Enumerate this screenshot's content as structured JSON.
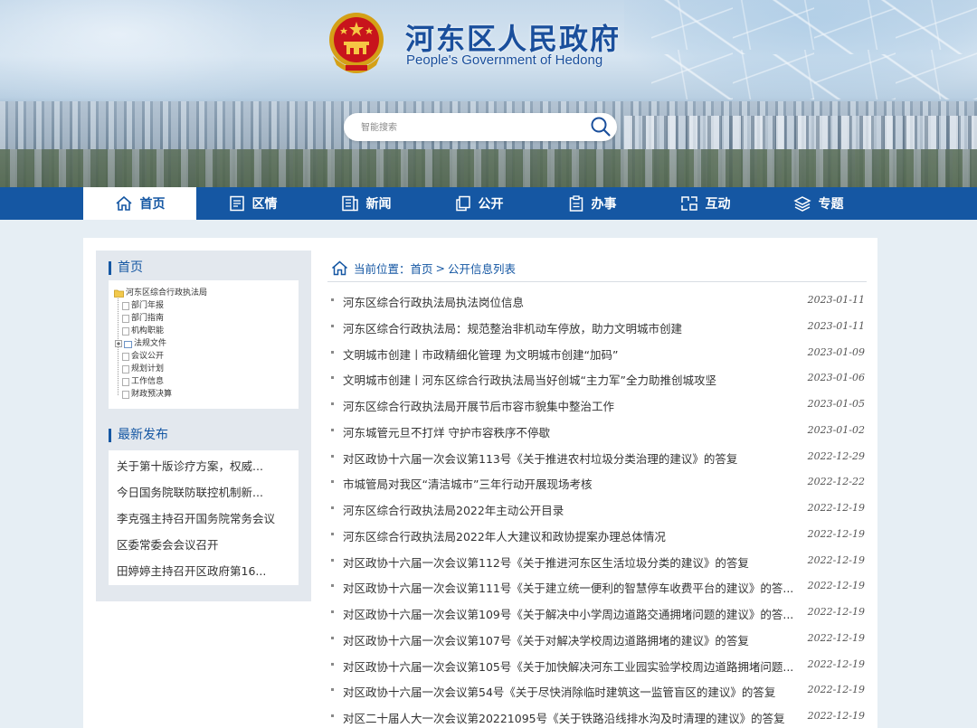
{
  "header": {
    "title": "河东区人民政府",
    "subtitle": "People's Government of Hedong",
    "emblem_icon": "national-emblem-icon"
  },
  "search": {
    "placeholder": "智能搜索",
    "value": "",
    "icon": "search-icon"
  },
  "nav": {
    "items": [
      {
        "label": "首页",
        "icon": "home-icon",
        "active": true
      },
      {
        "label": "区情",
        "icon": "document-icon",
        "active": false
      },
      {
        "label": "新闻",
        "icon": "newspaper-icon",
        "active": false
      },
      {
        "label": "公开",
        "icon": "copy-icon",
        "active": false
      },
      {
        "label": "办事",
        "icon": "clipboard-icon",
        "active": false
      },
      {
        "label": "互动",
        "icon": "interact-icon",
        "active": false
      },
      {
        "label": "专题",
        "icon": "layers-icon",
        "active": false
      }
    ]
  },
  "sidebar": {
    "home_title": "首页",
    "tree": {
      "root": "河东区综合行政执法局",
      "children": [
        "部门年报",
        "部门指南",
        "机构职能",
        "法规文件",
        "会议公开",
        "规划计划",
        "工作信息",
        "财政预决算"
      ]
    },
    "latest_title": "最新发布",
    "latest": [
      "关于第十版诊疗方案，权威...",
      "今日国务院联防联控机制新...",
      "李克强主持召开国务院常务会议",
      "区委常委会会议召开",
      "田婷婷主持召开区政府第16..."
    ]
  },
  "breadcrumb": {
    "prefix": "当前位置：",
    "home": "首页",
    "separator": ">",
    "current": "公开信息列表"
  },
  "list": [
    {
      "title": "河东区综合行政执法局执法岗位信息",
      "date": "2023-01-11"
    },
    {
      "title": "河东区综合行政执法局：规范整治非机动车停放，助力文明城市创建",
      "date": "2023-01-11"
    },
    {
      "title": "文明城市创建丨市政精细化管理 为文明城市创建“加码”",
      "date": "2023-01-09"
    },
    {
      "title": "文明城市创建丨河东区综合行政执法局当好创城“主力军”全力助推创城攻坚",
      "date": "2023-01-06"
    },
    {
      "title": "河东区综合行政执法局开展节后市容市貌集中整治工作",
      "date": "2023-01-05"
    },
    {
      "title": "河东城管元旦不打烊 守护市容秩序不停歇",
      "date": "2023-01-02"
    },
    {
      "title": "对区政协十六届一次会议第113号《关于推进农村垃圾分类治理的建议》的答复",
      "date": "2022-12-29"
    },
    {
      "title": "市城管局对我区“清洁城市”三年行动开展现场考核",
      "date": "2022-12-22"
    },
    {
      "title": "河东区综合行政执法局2022年主动公开目录",
      "date": "2022-12-19"
    },
    {
      "title": "河东区综合行政执法局2022年人大建议和政协提案办理总体情况",
      "date": "2022-12-19"
    },
    {
      "title": "对区政协十六届一次会议第112号《关于推进河东区生活垃圾分类的建议》的答复",
      "date": "2022-12-19"
    },
    {
      "title": "对区政协十六届一次会议第111号《关于建立统一便利的智慧停车收费平台的建议》的答...",
      "date": "2022-12-19"
    },
    {
      "title": "对区政协十六届一次会议第109号《关于解决中小学周边道路交通拥堵问题的建议》的答...",
      "date": "2022-12-19"
    },
    {
      "title": "对区政协十六届一次会议第107号《关于对解决学校周边道路拥堵的建议》的答复",
      "date": "2022-12-19"
    },
    {
      "title": "对区政协十六届一次会议第105号《关于加快解决河东工业园实验学校周边道路拥堵问题...",
      "date": "2022-12-19"
    },
    {
      "title": "对区政协十六届一次会议第54号《关于尽快消除临时建筑这一监管盲区的建议》的答复",
      "date": "2022-12-19"
    },
    {
      "title": "对区二十届人大一次会议第20221095号《关于铁路沿线排水沟及时清理的建议》的答复",
      "date": "2022-12-19"
    }
  ],
  "colors": {
    "primary_blue": "#1557a3",
    "title_blue": "#1a4f9c",
    "sidebar_bg": "#e3e8ee",
    "page_bg": "#e6eef4"
  }
}
